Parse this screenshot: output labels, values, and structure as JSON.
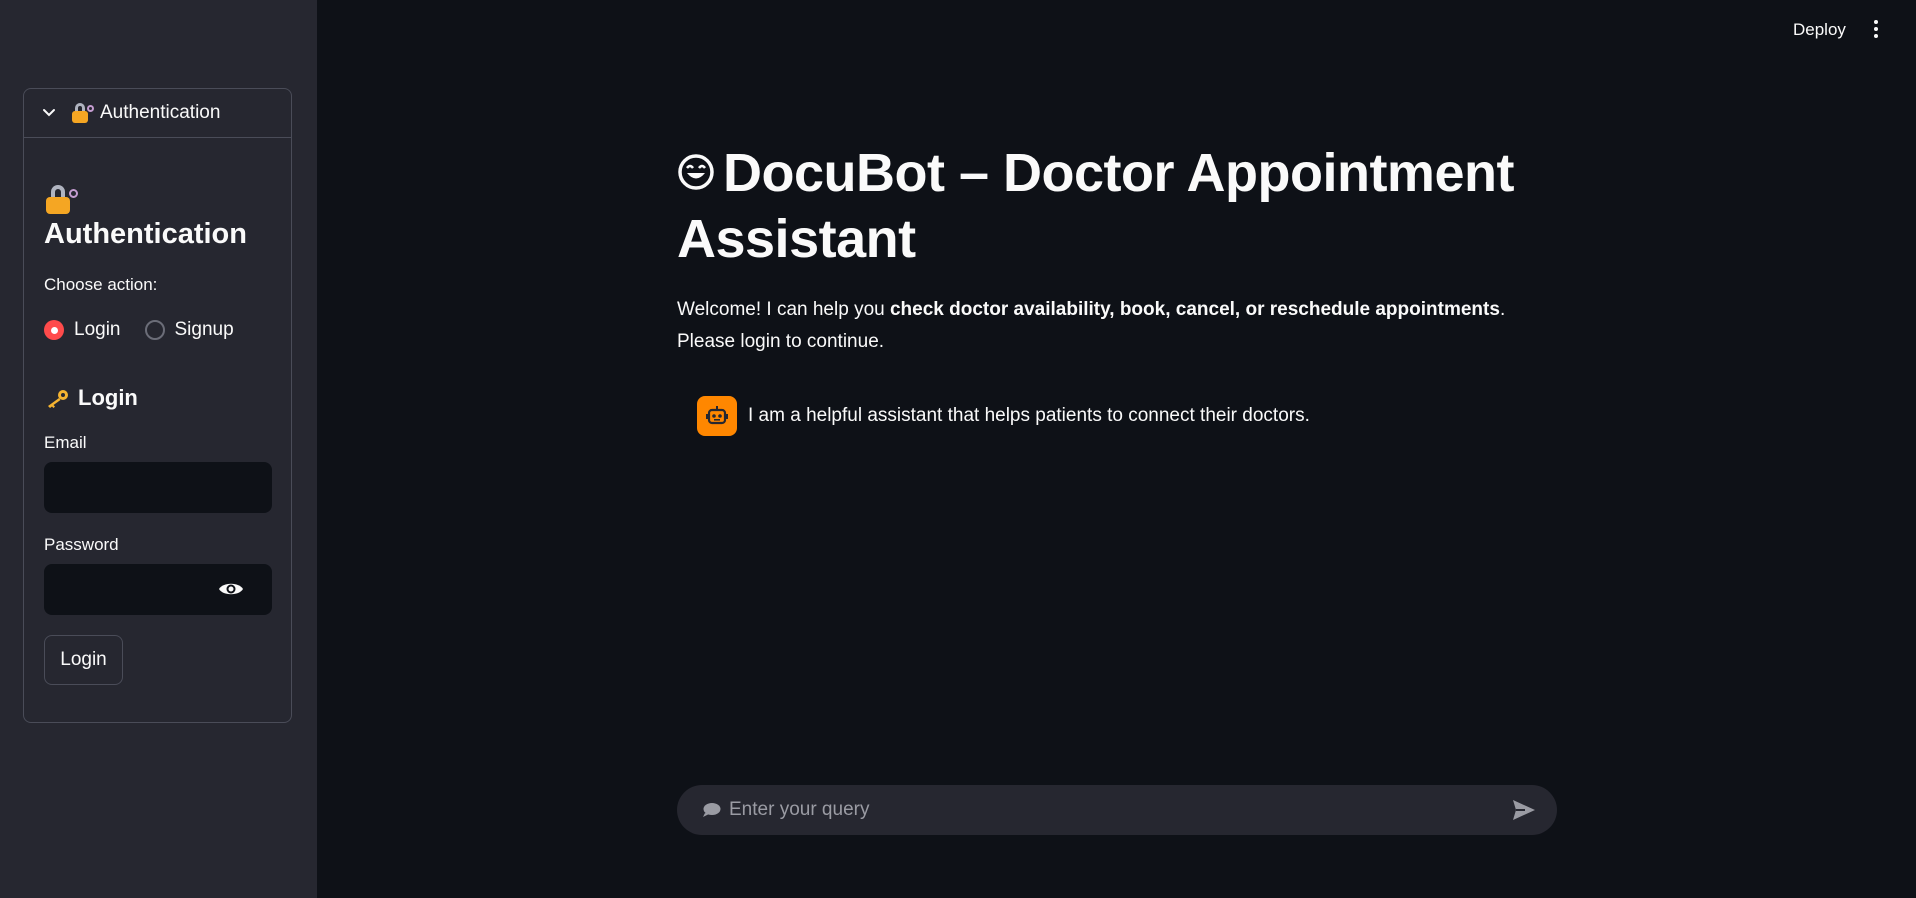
{
  "sidebar": {
    "expander_label": "Authentication",
    "title": "Authentication",
    "choose_action_label": "Choose action:",
    "radio_options": [
      "Login",
      "Signup"
    ],
    "selected_option": "Login",
    "login_heading": "Login",
    "email_label": "Email",
    "password_label": "Password",
    "login_button": "Login"
  },
  "header": {
    "deploy_label": "Deploy"
  },
  "main": {
    "title": "DocuBot – Doctor Appointment Assistant",
    "welcome_prefix": "Welcome! I can help you ",
    "welcome_bold": "check doctor availability, book, cancel, or reschedule appointments",
    "welcome_suffix": ". Please login to continue.",
    "assistant_message": "I am a helpful assistant that helps patients to connect their doctors."
  },
  "chat_input": {
    "placeholder": "Enter your query"
  },
  "colors": {
    "background": "#0e1117",
    "sidebar": "#262730",
    "accent": "#ff4b4b",
    "avatar": "#ff8700"
  }
}
